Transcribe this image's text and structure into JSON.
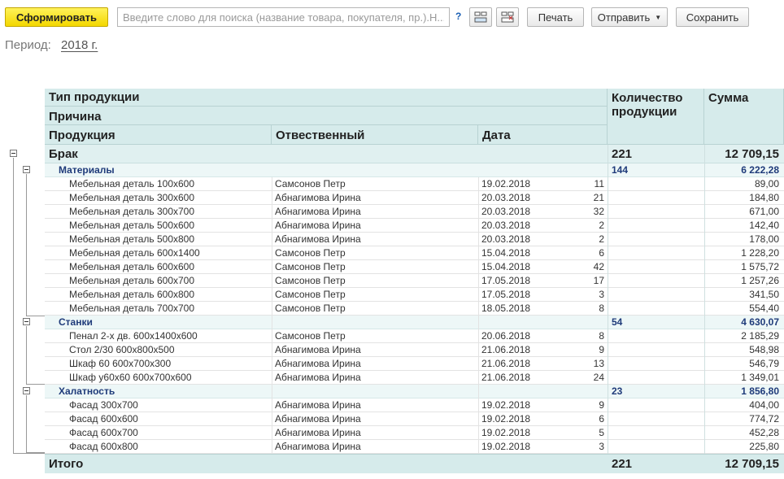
{
  "toolbar": {
    "generate_label": "Сформировать",
    "search_placeholder": "Введите слово для поиска (название товара, покупателя, пр.).Н...",
    "help_label": "?",
    "print_label": "Печать",
    "send_label": "Отправить",
    "save_label": "Сохранить"
  },
  "period": {
    "label": "Период:",
    "value": "2018 г."
  },
  "header": {
    "product_type": "Тип продукции",
    "reason": "Причина",
    "product": "Продукция",
    "responsible": "Отвественный",
    "date": "Дата",
    "quantity": "Количество продукции",
    "sum": "Сумма"
  },
  "groups": [
    {
      "name": "Брак",
      "quantity": "221",
      "sum": "12 709,15",
      "subgroups": [
        {
          "name": "Материалы",
          "quantity": "144",
          "sum": "6 222,28",
          "rows": [
            {
              "product": "Мебельная деталь 100х600",
              "person": "Самсонов Петр",
              "date": "19.02.2018",
              "qty": "11",
              "sum": "89,00"
            },
            {
              "product": "Мебельная деталь 300х600",
              "person": "Абнагимова Ирина",
              "date": "20.03.2018",
              "qty": "21",
              "sum": "184,80"
            },
            {
              "product": "Мебельная деталь 300х700",
              "person": "Абнагимова Ирина",
              "date": "20.03.2018",
              "qty": "32",
              "sum": "671,00"
            },
            {
              "product": "Мебельная деталь 500х600",
              "person": "Абнагимова Ирина",
              "date": "20.03.2018",
              "qty": "2",
              "sum": "142,40"
            },
            {
              "product": "Мебельная деталь 500х800",
              "person": "Абнагимова Ирина",
              "date": "20.03.2018",
              "qty": "2",
              "sum": "178,00"
            },
            {
              "product": "Мебельная деталь 600х1400",
              "person": "Самсонов Петр",
              "date": "15.04.2018",
              "qty": "6",
              "sum": "1 228,20"
            },
            {
              "product": "Мебельная деталь 600х600",
              "person": "Самсонов Петр",
              "date": "15.04.2018",
              "qty": "42",
              "sum": "1 575,72"
            },
            {
              "product": "Мебельная деталь 600х700",
              "person": "Самсонов Петр",
              "date": "17.05.2018",
              "qty": "17",
              "sum": "1 257,26"
            },
            {
              "product": "Мебельная деталь 600х800",
              "person": "Самсонов Петр",
              "date": "17.05.2018",
              "qty": "3",
              "sum": "341,50"
            },
            {
              "product": "Мебельная деталь 700х700",
              "person": "Самсонов Петр",
              "date": "18.05.2018",
              "qty": "8",
              "sum": "554,40"
            }
          ]
        },
        {
          "name": "Станки",
          "quantity": "54",
          "sum": "4 630,07",
          "rows": [
            {
              "product": "Пенал 2-х дв. 600х1400х600",
              "person": "Самсонов Петр",
              "date": "20.06.2018",
              "qty": "8",
              "sum": "2 185,29"
            },
            {
              "product": "Стол 2/30 600х800х500",
              "person": "Абнагимова Ирина",
              "date": "21.06.2018",
              "qty": "9",
              "sum": "548,98"
            },
            {
              "product": "Шкаф 60 600х700х300",
              "person": "Абнагимова Ирина",
              "date": "21.06.2018",
              "qty": "13",
              "sum": "546,79"
            },
            {
              "product": "Шкаф у60х60 600х700х600",
              "person": "Абнагимова Ирина",
              "date": "21.06.2018",
              "qty": "24",
              "sum": "1 349,01"
            }
          ]
        },
        {
          "name": "Халатность",
          "quantity": "23",
          "sum": "1 856,80",
          "rows": [
            {
              "product": "Фасад 300х700",
              "person": "Абнагимова Ирина",
              "date": "19.02.2018",
              "qty": "9",
              "sum": "404,00"
            },
            {
              "product": "Фасад 600х600",
              "person": "Абнагимова Ирина",
              "date": "19.02.2018",
              "qty": "6",
              "sum": "774,72"
            },
            {
              "product": "Фасад 600х700",
              "person": "Абнагимова Ирина",
              "date": "19.02.2018",
              "qty": "5",
              "sum": "452,28"
            },
            {
              "product": "Фасад 600х800",
              "person": "Абнагимова Ирина",
              "date": "19.02.2018",
              "qty": "3",
              "sum": "225,80"
            }
          ]
        }
      ]
    }
  ],
  "total": {
    "label": "Итого",
    "quantity": "221",
    "sum": "12 709,15"
  }
}
